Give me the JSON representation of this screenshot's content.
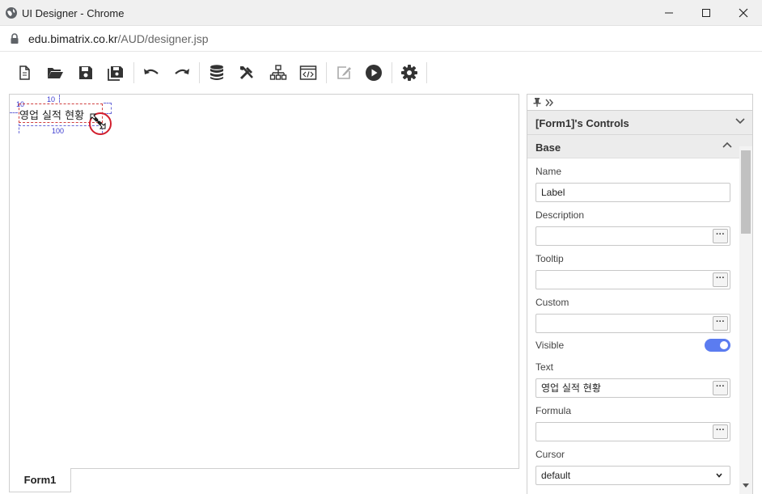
{
  "window": {
    "title": "UI Designer - Chrome",
    "app_icon": "globe-icon",
    "controls": [
      "minimize-icon",
      "maximize-icon",
      "close-icon"
    ]
  },
  "address": {
    "domain": "edu.bimatrix.co.kr",
    "path": "/AUD/designer.jsp",
    "icon": "lock-icon"
  },
  "toolbar": {
    "groups": [
      [
        "new-document-icon",
        "open-folder-icon",
        "save-icon",
        "save-all-icon"
      ],
      [
        "undo-icon",
        "redo-icon"
      ],
      [
        "database-icon",
        "tools-icon",
        "hierarchy-icon",
        "code-window-icon"
      ],
      [
        "edit-icon",
        "run-icon"
      ],
      [
        "settings-gear-icon"
      ]
    ]
  },
  "canvas": {
    "selected_label_text": "영업 실적 현황",
    "dim_top": "10",
    "dim_left": "10",
    "dim_width": "100",
    "cursor": "resize-diagonal-icon"
  },
  "form_tab": "Form1",
  "panel": {
    "controls_title": "[Form1]'s Controls",
    "section": "Base",
    "properties": {
      "name_label": "Name",
      "name_value": "Label",
      "description_label": "Description",
      "description_value": "",
      "tooltip_label": "Tooltip",
      "tooltip_value": "",
      "custom_label": "Custom",
      "custom_value": "",
      "visible_label": "Visible",
      "visible_value": true,
      "text_label": "Text",
      "text_value": "영업 실적 현황",
      "formula_label": "Formula",
      "formula_value": "",
      "cursor_label": "Cursor",
      "cursor_value": "default"
    },
    "dots": "···"
  },
  "colors": {
    "accent": "#5b7cf0",
    "selection": "#d04040",
    "guide": "#3a3ad0",
    "cursor_ring": "#d21f2e"
  }
}
